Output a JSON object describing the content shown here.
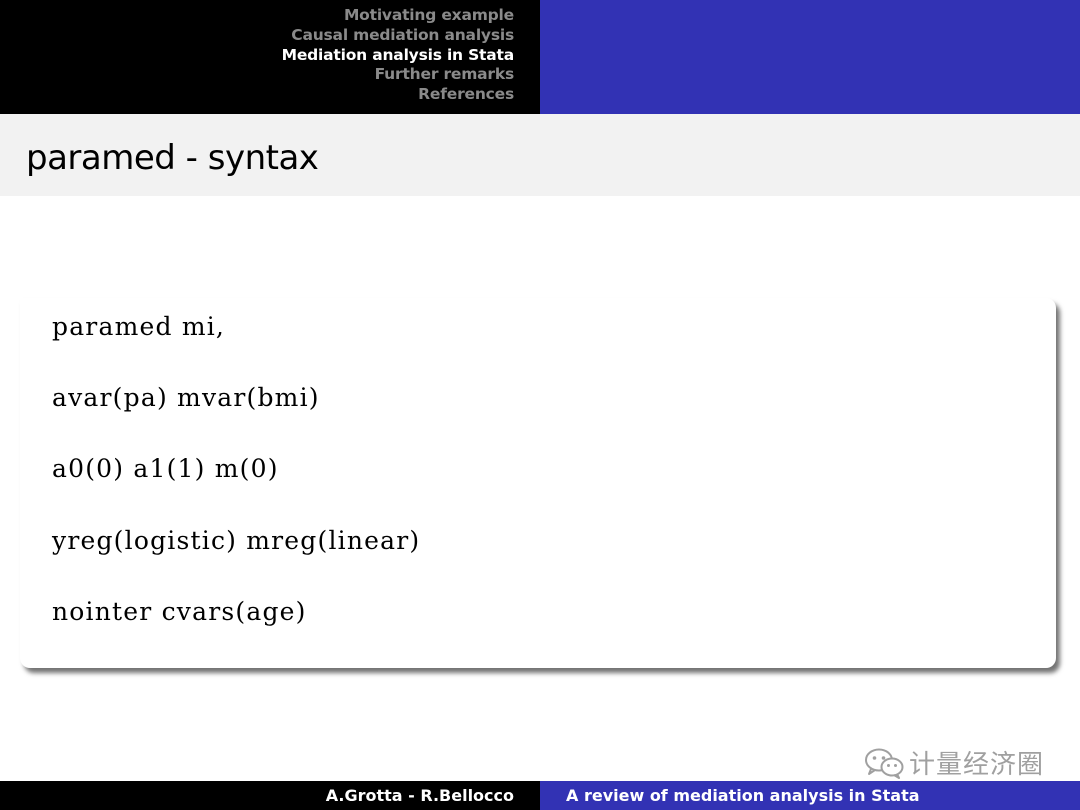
{
  "header": {
    "sections": [
      {
        "label": "Motivating example",
        "active": false
      },
      {
        "label": "Causal mediation analysis",
        "active": false
      },
      {
        "label": "Mediation analysis in Stata",
        "active": true
      },
      {
        "label": "Further remarks",
        "active": false
      },
      {
        "label": "References",
        "active": false
      }
    ]
  },
  "frame": {
    "title": "paramed - syntax"
  },
  "code": {
    "lines": [
      "paramed mi,",
      "avar(pa) mvar(bmi)",
      "a0(0) a1(1) m(0)",
      "yreg(logistic) mreg(linear)",
      "nointer cvars(age)"
    ]
  },
  "watermark": {
    "icon": "wechat-icon",
    "text": "计量经济圈"
  },
  "footer": {
    "authors": "A.Grotta - R.Bellocco",
    "talk_title": "A review of mediation analysis in Stata"
  },
  "colors": {
    "nav_left_bg": "#000000",
    "nav_right_bg": "#3232b4",
    "nav_inactive": "#8a8a8a",
    "nav_active": "#ffffff",
    "title_bar_bg": "#f2f2f2"
  }
}
